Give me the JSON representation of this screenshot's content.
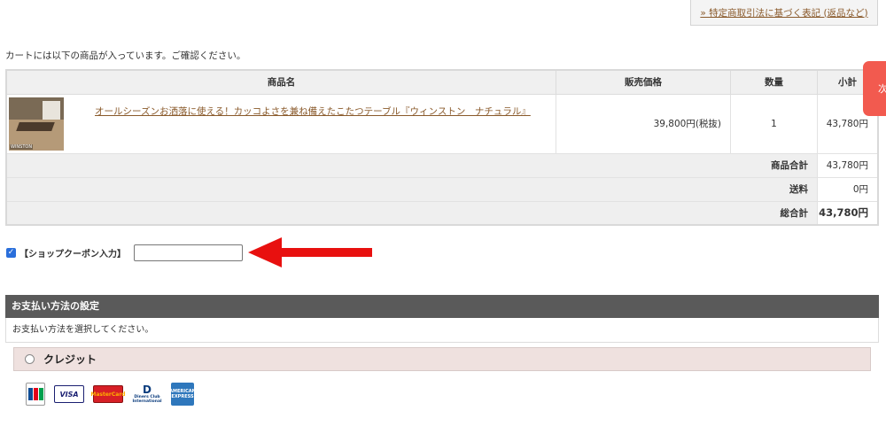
{
  "header": {
    "legal_link": "» 特定商取引法に基づく表記 (返品など)"
  },
  "intro": "カートには以下の商品が入っています。ご確認ください。",
  "cart": {
    "columns": [
      "商品名",
      "販売価格",
      "数量",
      "小計"
    ],
    "item": {
      "thumbnail_brand": "WINSTON",
      "name": "オールシーズンお洒落に使える！カッコよさを兼ね備えたこたつテーブル『ウィンストン　ナチュラル』",
      "price": "39,800円(税抜)",
      "quantity": "1",
      "subtotal": "43,780円"
    },
    "summary": [
      {
        "label": "商品合計",
        "value": "43,780円"
      },
      {
        "label": "送料",
        "value": "0円"
      },
      {
        "label": "総合計",
        "value": "43,780円"
      }
    ]
  },
  "coupon": {
    "checked": true,
    "label": "【ショップクーポン入力】",
    "value": ""
  },
  "side_tab": {
    "text": "次"
  },
  "payment": {
    "title": "お支払い方法の設定",
    "description": "お支払い方法を選択してください。",
    "option_label": "クレジット",
    "cards": [
      {
        "icon": "jcb-card-icon",
        "text": "JCB"
      },
      {
        "icon": "visa-card-icon",
        "text": "VISA"
      },
      {
        "icon": "mastercard-card-icon",
        "text": "MasterCard"
      },
      {
        "icon": "diners-club-card-icon",
        "text": "Diners Club International"
      },
      {
        "icon": "amex-card-icon",
        "text": "AMERICAN EXPRESS"
      }
    ]
  },
  "colors": {
    "accent_link": "#8a5a2b",
    "side_tab": "#f25a4f",
    "arrow": "#e8100f",
    "section_header": "#5a5a5a"
  }
}
